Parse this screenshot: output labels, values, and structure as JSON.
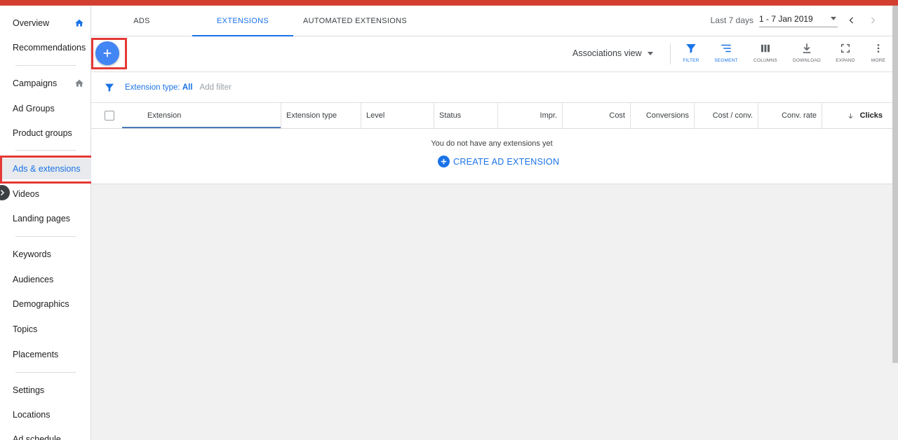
{
  "sidebar": {
    "items": [
      {
        "label": "Overview"
      },
      {
        "label": "Recommendations"
      },
      {
        "label": "Campaigns"
      },
      {
        "label": "Ad Groups"
      },
      {
        "label": "Product groups"
      },
      {
        "label": "Ads & extensions"
      },
      {
        "label": "Videos"
      },
      {
        "label": "Landing pages"
      },
      {
        "label": "Keywords"
      },
      {
        "label": "Audiences"
      },
      {
        "label": "Demographics"
      },
      {
        "label": "Topics"
      },
      {
        "label": "Placements"
      },
      {
        "label": "Settings"
      },
      {
        "label": "Locations"
      },
      {
        "label": "Ad schedule"
      }
    ],
    "active_item": "Ads & extensions"
  },
  "tabs": [
    {
      "label": "ADS"
    },
    {
      "label": "EXTENSIONS"
    },
    {
      "label": "AUTOMATED EXTENSIONS"
    }
  ],
  "active_tab": "EXTENSIONS",
  "date_range": {
    "label": "Last 7 days",
    "value": "1 - 7 Jan 2019"
  },
  "toolbar": {
    "view_label": "Associations view",
    "buttons": [
      {
        "label": "FILTER",
        "icon": "filter-icon"
      },
      {
        "label": "SEGMENT",
        "icon": "segment-icon"
      },
      {
        "label": "COLUMNS",
        "icon": "columns-icon"
      },
      {
        "label": "DOWNLOAD",
        "icon": "download-icon"
      },
      {
        "label": "EXPAND",
        "icon": "expand-icon"
      },
      {
        "label": "MORE",
        "icon": "more-icon"
      }
    ]
  },
  "filter": {
    "type_label": "Extension type: ",
    "type_value": "All",
    "add_filter": "Add filter"
  },
  "table": {
    "columns": [
      "Extension",
      "Extension type",
      "Level",
      "Status",
      "Impr.",
      "Cost",
      "Conversions",
      "Cost / conv.",
      "Conv. rate",
      "Clicks"
    ],
    "sorted_column": "Clicks",
    "empty_message": "You do not have any extensions yet",
    "create_label": "CREATE AD EXTENSION"
  },
  "colors": {
    "accent": "#1a73e8",
    "fab": "#4285f4",
    "top_bar": "#d23f31",
    "highlight": "#e53935"
  }
}
